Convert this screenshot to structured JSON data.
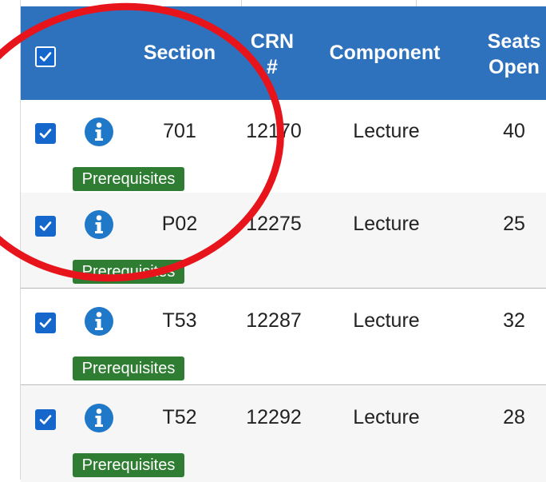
{
  "header": {
    "section_label": "Section",
    "crn_line1": "CRN",
    "crn_line2": "#",
    "component_label": "Component",
    "seats_line1": "Seats",
    "seats_line2": "Open"
  },
  "rows": [
    {
      "section": "701",
      "crn": "12170",
      "component": "Lecture",
      "seats_open": "40",
      "badge": "Prerequisites",
      "checked": true
    },
    {
      "section": "P02",
      "crn": "12275",
      "component": "Lecture",
      "seats_open": "25",
      "badge": "Prerequisites",
      "checked": true
    },
    {
      "section": "T53",
      "crn": "12287",
      "component": "Lecture",
      "seats_open": "32",
      "badge": "Prerequisites",
      "checked": true
    },
    {
      "section": "T52",
      "crn": "12292",
      "component": "Lecture",
      "seats_open": "28",
      "badge": "Prerequisites",
      "checked": true
    }
  ],
  "icons": {
    "info": "info-circle-icon",
    "check": "check-icon"
  },
  "colors": {
    "header_bg": "#2e72be",
    "checkbox": "#1667cc",
    "info_icon": "#1f78c8",
    "badge_bg": "#2f7d32",
    "annotation_circle": "#e8141c"
  }
}
